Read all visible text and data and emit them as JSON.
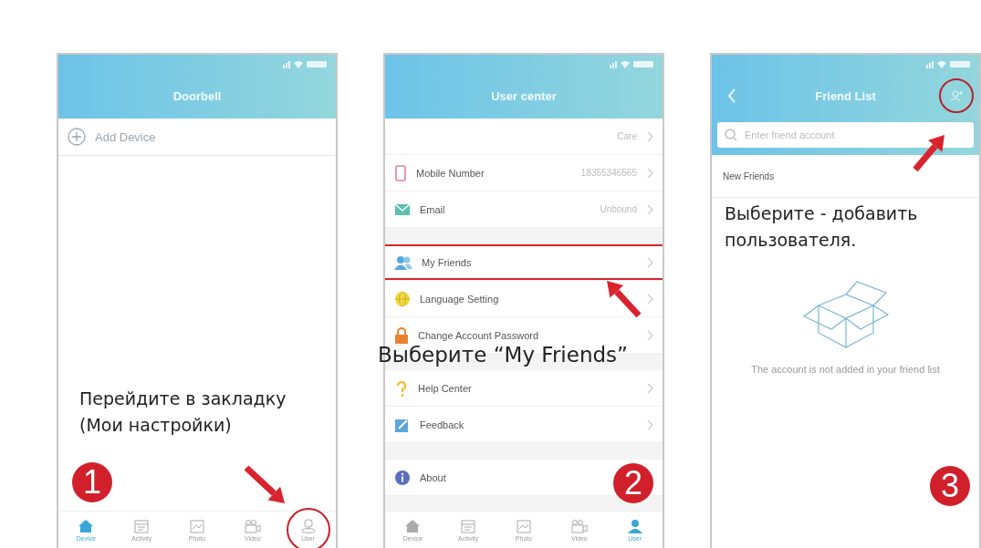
{
  "screens": [
    {
      "kind": "devices",
      "title": "Doorbell",
      "add_label": "Add Device",
      "step": "1",
      "instruction": "Перейдите в закладку\n(Мои настройки)",
      "tabs": [
        {
          "label": "Device",
          "selected": true,
          "circled": false
        },
        {
          "label": "Activity",
          "selected": false,
          "circled": false
        },
        {
          "label": "Photo",
          "selected": false,
          "circled": false
        },
        {
          "label": "Video",
          "selected": false,
          "circled": false
        },
        {
          "label": "User",
          "selected": false,
          "circled": true
        }
      ]
    },
    {
      "kind": "settings",
      "title": "User center",
      "step": "2",
      "instruction": "Выберите “My Friends”",
      "groups": [
        {
          "rows": [
            {
              "label": "",
              "value": "Care",
              "highlighted": false
            },
            {
              "label": "Mobile Number",
              "value": "18365346565",
              "highlighted": false
            },
            {
              "label": "Email",
              "value": "Unbound",
              "highlighted": false
            }
          ]
        },
        {
          "rows": [
            {
              "label": "My Friends",
              "value": "",
              "highlighted": true
            },
            {
              "label": "Language Setting",
              "value": "",
              "highlighted": false
            },
            {
              "label": "Change Account Password",
              "value": "",
              "highlighted": false
            }
          ]
        },
        {
          "rows": [
            {
              "label": "Help Center",
              "value": "",
              "highlighted": false
            },
            {
              "label": "Feedback",
              "value": "",
              "highlighted": false
            }
          ]
        },
        {
          "rows": [
            {
              "label": "About",
              "value": "",
              "highlighted": false
            }
          ]
        }
      ],
      "tabs": [
        {
          "label": "Device",
          "selected": false,
          "circled": false
        },
        {
          "label": "Activity",
          "selected": false,
          "circled": false
        },
        {
          "label": "Photo",
          "selected": false,
          "circled": false
        },
        {
          "label": "Video",
          "selected": false,
          "circled": false
        },
        {
          "label": "User",
          "selected": true,
          "circled": false
        }
      ]
    },
    {
      "kind": "friends",
      "title": "Friend List",
      "add_circled": true,
      "search_placeholder": "Enter friend account",
      "section": "New Friends",
      "empty_text": "The account is not added in your friend list",
      "step": "3",
      "instruction": "Выберите - добавить\nпользователя."
    }
  ]
}
